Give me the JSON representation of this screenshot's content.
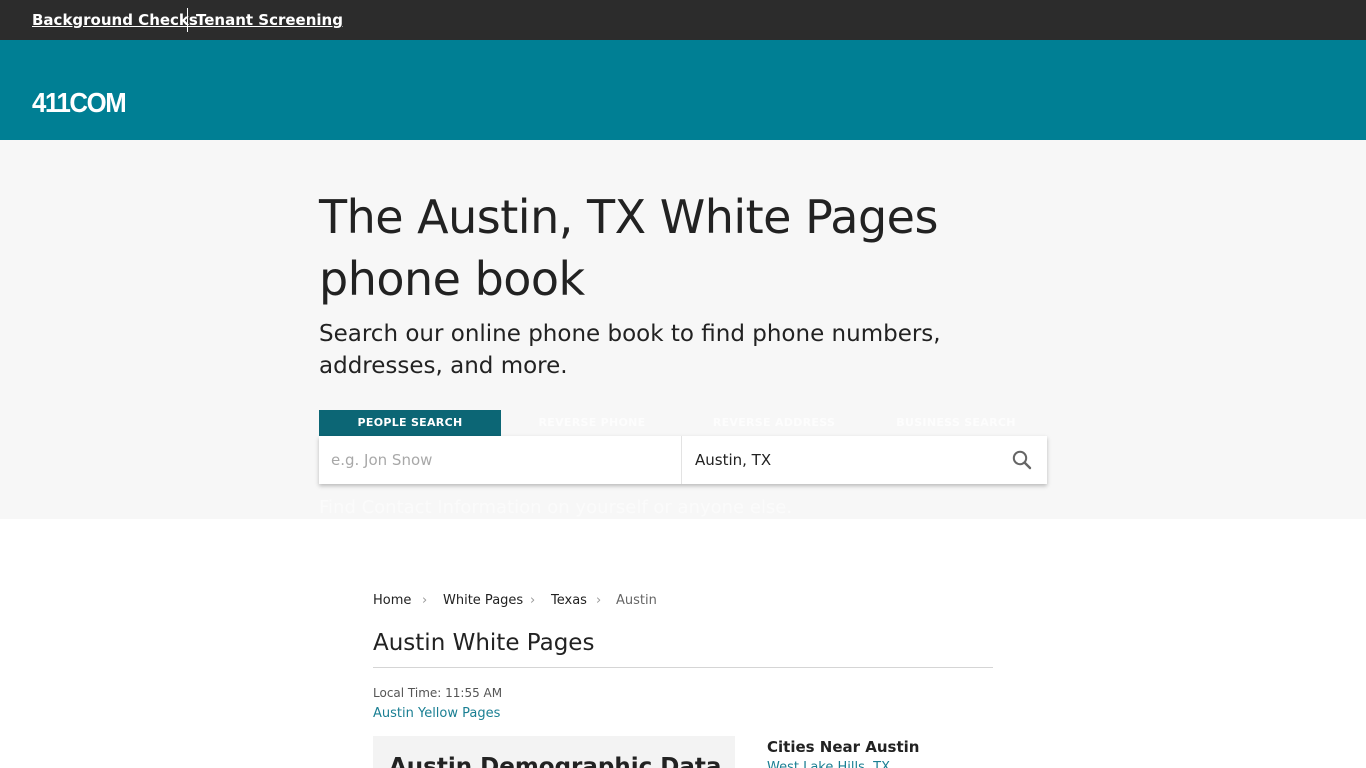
{
  "topbar": {
    "links": [
      "Background Checks",
      "Tenant Screening"
    ]
  },
  "header": {
    "logo_text": "411COM"
  },
  "hero": {
    "title": "The Austin, TX White Pages phone book",
    "subtitle": "Search our online phone book to find phone numbers, addresses, and more.",
    "tabs": [
      "PEOPLE SEARCH",
      "REVERSE PHONE",
      "REVERSE ADDRESS",
      "BUSINESS SEARCH"
    ],
    "active_tab": "PEOPLE SEARCH",
    "name_placeholder": "e.g. Jon Snow",
    "location_value": "Austin, TX",
    "note": "Find Contact Information on yourself or anyone else."
  },
  "breadcrumb": [
    "Home",
    "White Pages",
    "Texas",
    "Austin"
  ],
  "main": {
    "title": "Austin White Pages",
    "local_time": "Local Time: 11:55 AM",
    "yellow_pages_link": "Austin Yellow Pages",
    "demographic_title": "Austin Demographic Data",
    "cities_heading": "Cities Near Austin",
    "cities": [
      "West Lake Hills, TX"
    ]
  },
  "colors": {
    "topbar": "#2c2c2c",
    "header": "#007f94",
    "active_tab": "#0c6675",
    "link": "#1a7f93"
  },
  "icons": {
    "search": "search-icon",
    "chevron": "chevron-right-icon"
  }
}
